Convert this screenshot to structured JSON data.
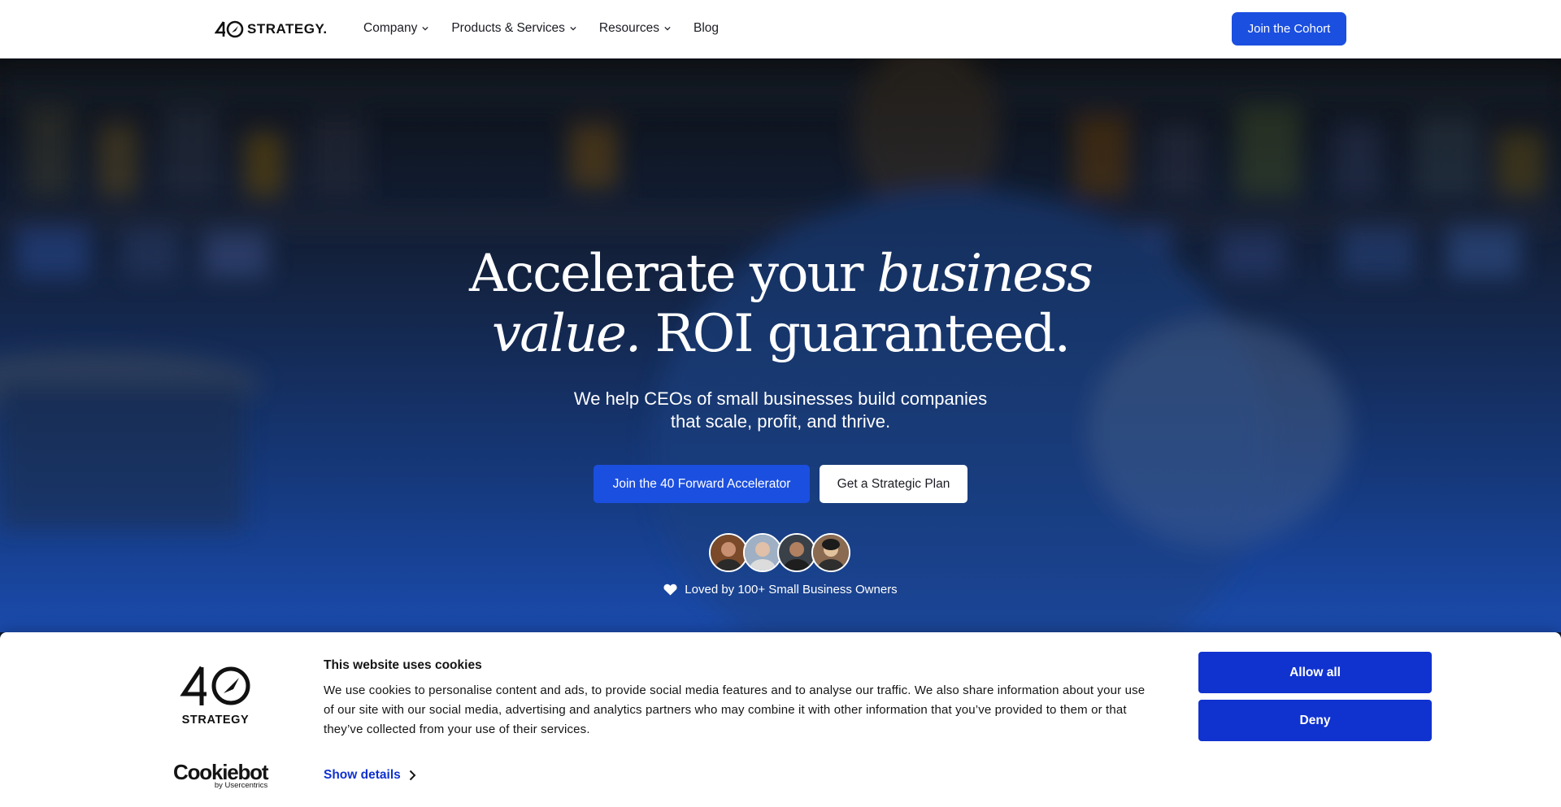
{
  "nav": {
    "logo_text": "STRATEGY.",
    "items": [
      {
        "label": "Company",
        "has_dropdown": true
      },
      {
        "label": "Products & Services",
        "has_dropdown": true
      },
      {
        "label": "Resources",
        "has_dropdown": true
      },
      {
        "label": "Blog",
        "has_dropdown": false
      }
    ],
    "cta_label": "Join the Cohort"
  },
  "hero": {
    "title_part1": "Accelerate your ",
    "title_em1": "business",
    "title_em2": "value.",
    "title_part2": " ROI guaranteed.",
    "subtitle_line1": "We help CEOs of small businesses build companies",
    "subtitle_line2": "that scale, profit, and thrive.",
    "primary_button": "Join the 40 Forward Accelerator",
    "secondary_button": "Get a Strategic Plan",
    "avatars": [
      "avatar-1",
      "avatar-2",
      "avatar-3",
      "avatar-4"
    ],
    "loved_text": "Loved by 100+ Small Business Owners"
  },
  "cookie_banner": {
    "logo_text": "STRATEGY",
    "title": "This website uses cookies",
    "body": "We use cookies to personalise content and ads, to provide social media features and to analyse our traffic. We also share information about your use of our site with our social media, advertising and analytics partners who may combine it with other information that you’ve provided to them or that they’ve collected from your use of their services.",
    "show_details": "Show details",
    "allow_all": "Allow all",
    "deny": "Deny",
    "cookiebot_name": "Cookiebot",
    "cookiebot_by": "by Usercentrics"
  },
  "colors": {
    "accent": "#1b4fe0",
    "cookie_accent": "#1032cf"
  }
}
